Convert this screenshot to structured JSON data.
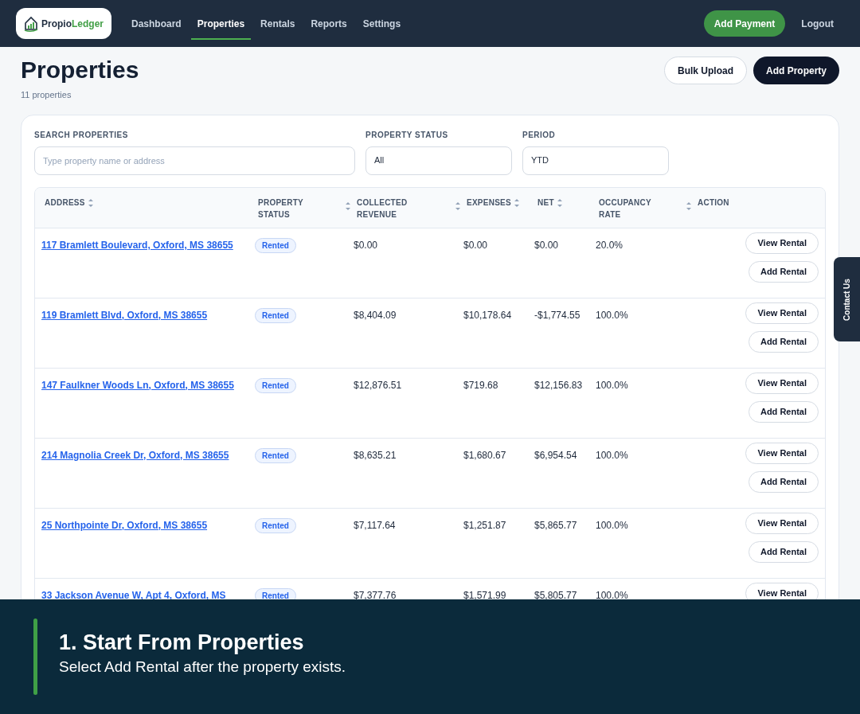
{
  "nav": {
    "logo": {
      "prefix": "Propio",
      "suffix": "Ledger"
    },
    "items": [
      {
        "label": "Dashboard",
        "selected": false
      },
      {
        "label": "Properties",
        "selected": true
      },
      {
        "label": "Rentals",
        "selected": false
      },
      {
        "label": "Reports",
        "selected": false
      },
      {
        "label": "Settings",
        "selected": false
      }
    ],
    "add_payment": "Add Payment",
    "logout": "Logout"
  },
  "page": {
    "title": "Properties",
    "count": "11 properties",
    "buttons": [
      {
        "label": "Bulk Upload",
        "kind": "secondary"
      },
      {
        "label": "Add Property",
        "kind": "primary"
      }
    ]
  },
  "filters": [
    {
      "label": "SEARCH PROPERTIES",
      "placeholder": "Type property name or address"
    },
    {
      "label": "PROPERTY STATUS",
      "value": "All"
    },
    {
      "label": "PERIOD",
      "value": "YTD"
    }
  ],
  "table": {
    "columns": [
      {
        "label": "ADDRESS",
        "sortable": true
      },
      {
        "label": "PROPERTY STATUS",
        "sortable": true
      },
      {
        "label": "COLLECTED REVENUE",
        "sortable": true
      },
      {
        "label": "EXPENSES",
        "sortable": true
      },
      {
        "label": "NET",
        "sortable": true
      },
      {
        "label": "OCCUPANCY RATE",
        "sortable": true
      },
      {
        "label": "ACTION",
        "sortable": false
      }
    ],
    "rows": [
      {
        "address": "117 Bramlett Boulevard, Oxford, MS 38655",
        "status": "Rented",
        "revenue": "$0.00",
        "expenses": "$0.00",
        "net": "$0.00",
        "occupancy": "20.0%",
        "actions": [
          "View Rental",
          "Add Rental"
        ]
      },
      {
        "address": "119 Bramlett Blvd, Oxford, MS 38655",
        "status": "Rented",
        "revenue": "$8,404.09",
        "expenses": "$10,178.64",
        "net": "-$1,774.55",
        "occupancy": "100.0%",
        "actions": [
          "View Rental",
          "Add Rental"
        ]
      },
      {
        "address": "147 Faulkner Woods Ln, Oxford, MS 38655",
        "status": "Rented",
        "revenue": "$12,876.51",
        "expenses": "$719.68",
        "net": "$12,156.83",
        "occupancy": "100.0%",
        "actions": [
          "View Rental",
          "Add Rental"
        ]
      },
      {
        "address": "214 Magnolia Creek Dr, Oxford, MS 38655",
        "status": "Rented",
        "revenue": "$8,635.21",
        "expenses": "$1,680.67",
        "net": "$6,954.54",
        "occupancy": "100.0%",
        "actions": [
          "View Rental",
          "Add Rental"
        ]
      },
      {
        "address": "25 Northpointe Dr, Oxford, MS 38655",
        "status": "Rented",
        "revenue": "$7,117.64",
        "expenses": "$1,251.87",
        "net": "$5,865.77",
        "occupancy": "100.0%",
        "actions": [
          "View Rental",
          "Add Rental"
        ]
      },
      {
        "address": "33 Jackson Avenue W, Apt 4, Oxford, MS",
        "status": "Rented",
        "revenue": "$7,377.76",
        "expenses": "$1,571.99",
        "net": "$5,805.77",
        "occupancy": "100.0%",
        "actions": [
          "View Rental"
        ]
      }
    ]
  },
  "contact_tab": "Contact Us",
  "caption": {
    "title": "1. Start From Properties",
    "text": "Select Add Rental after the property exists."
  }
}
